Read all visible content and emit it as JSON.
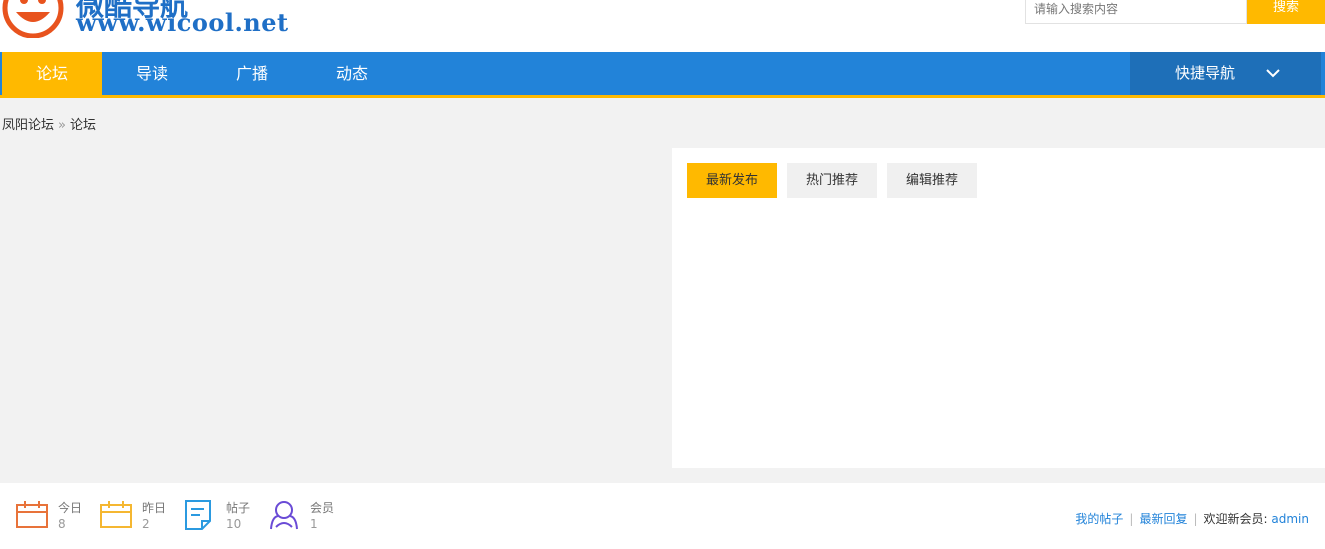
{
  "header": {
    "logo_url_text": "www.wicool.net",
    "logo_cn_text": "微酷导航",
    "search_placeholder": "请输入搜索内容",
    "search_button": "搜索"
  },
  "nav": {
    "items": [
      {
        "label": "论坛"
      },
      {
        "label": "导读"
      },
      {
        "label": "广播"
      },
      {
        "label": "动态"
      }
    ],
    "quick_nav": "快捷导航"
  },
  "breadcrumb": {
    "home": "凤阳论坛",
    "sep": "»",
    "current": "论坛"
  },
  "tabs": [
    {
      "label": "最新发布"
    },
    {
      "label": "热门推荐"
    },
    {
      "label": "编辑推荐"
    }
  ],
  "stats": [
    {
      "label": "今日",
      "value": "8",
      "icon": "calendar-today-icon"
    },
    {
      "label": "昨日",
      "value": "2",
      "icon": "calendar-yesterday-icon"
    },
    {
      "label": "帖子",
      "value": "10",
      "icon": "document-icon"
    },
    {
      "label": "会员",
      "value": "1",
      "icon": "members-icon"
    }
  ],
  "footer_links": {
    "my_posts": "我的帖子",
    "latest_replies": "最新回复",
    "welcome": "欢迎新会员:",
    "new_member": "admin"
  },
  "colors": {
    "brand_blue": "#2283d9",
    "accent_yellow": "#ffb900",
    "quick_nav_blue": "#1e6fb8"
  }
}
